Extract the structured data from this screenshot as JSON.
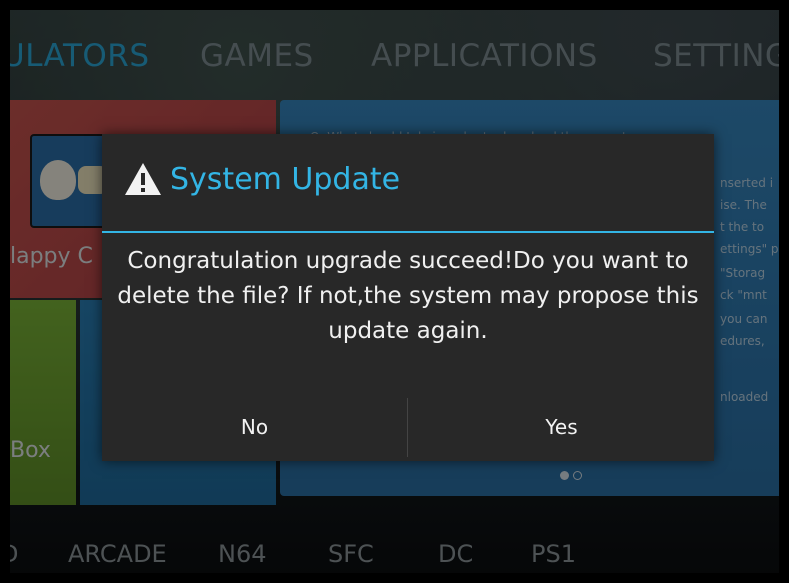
{
  "top_nav": {
    "tab1": "ULATORS",
    "tab2": "GAMES",
    "tab3": "APPLICATIONS",
    "tab4": "SETTING"
  },
  "tiles": {
    "red_label": "lappy C",
    "green_label": "Box"
  },
  "panel": {
    "lines": [
      "Q: What should I do in order to download the game to",
      "nserted i",
      "ise. The",
      "t the to",
      "ettings\" p",
      "\"Storag",
      "ck \"mnt",
      "you can",
      "edures,",
      "nloaded"
    ]
  },
  "dialog": {
    "title": "System Update",
    "icon": "warning-icon",
    "message": "Congratulation upgrade succeed!Do you want to delete the file? If not,the system may propose this update again.",
    "buttons": {
      "no": "No",
      "yes": "Yes"
    }
  },
  "bottom_nav": {
    "item0": "D",
    "item1": "ARCADE",
    "item2": "N64",
    "item3": "SFC",
    "item4": "DC",
    "item5": "PS1"
  },
  "colors": {
    "accent": "#33b5e5",
    "dialog_bg": "#282828"
  }
}
